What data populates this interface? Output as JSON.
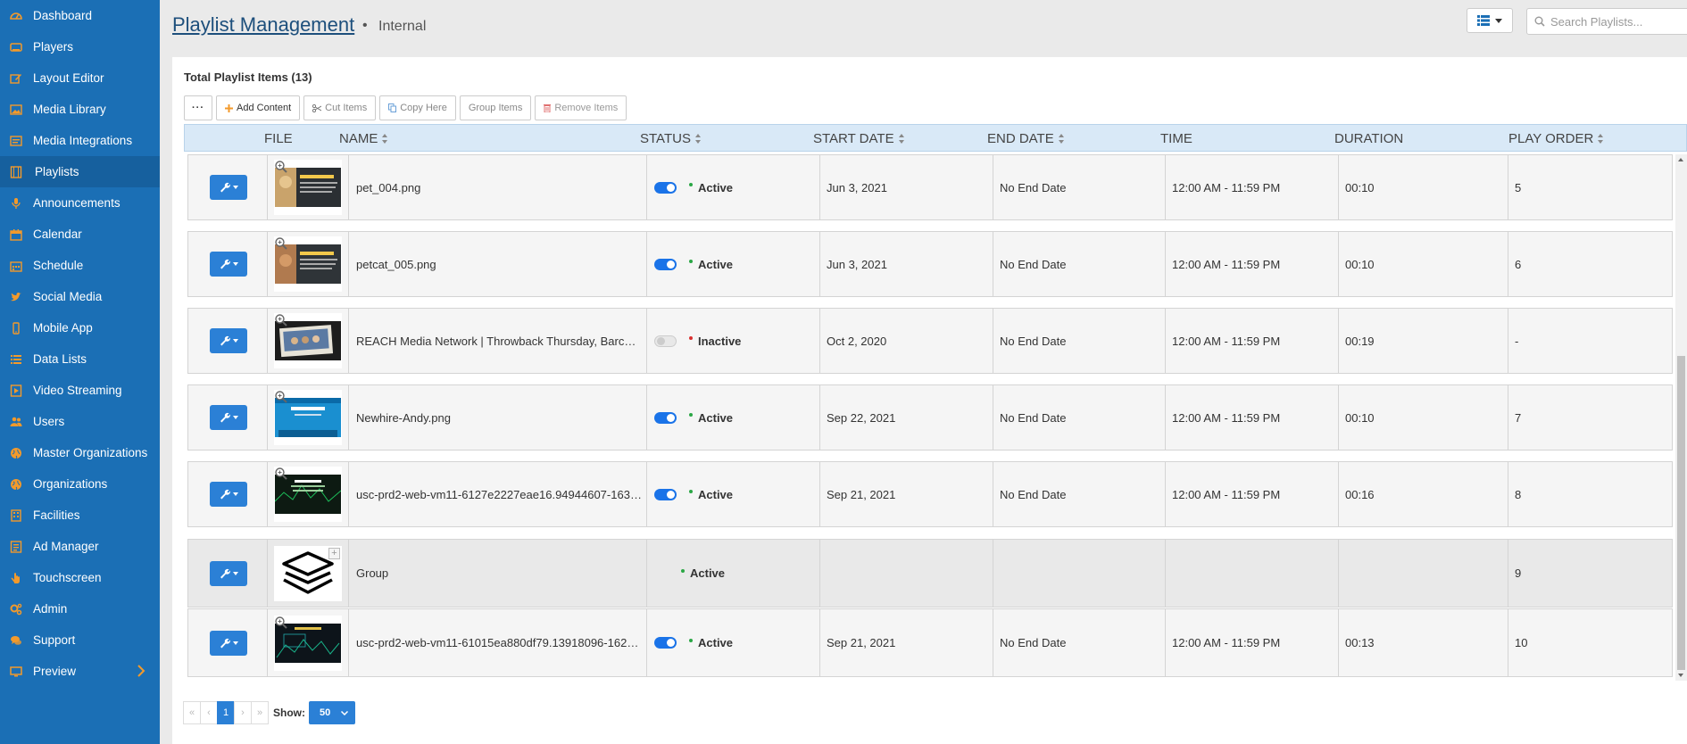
{
  "sidebar": {
    "items": [
      {
        "label": "Dashboard",
        "icon": "dashboard-icon"
      },
      {
        "label": "Players",
        "icon": "player-icon"
      },
      {
        "label": "Layout Editor",
        "icon": "edit-icon"
      },
      {
        "label": "Media Library",
        "icon": "image-icon"
      },
      {
        "label": "Media Integrations",
        "icon": "integrations-icon"
      },
      {
        "label": "Playlists",
        "icon": "film-icon"
      },
      {
        "label": "Announcements",
        "icon": "microphone-icon"
      },
      {
        "label": "Calendar",
        "icon": "calendar-icon"
      },
      {
        "label": "Schedule",
        "icon": "schedule-icon"
      },
      {
        "label": "Social Media",
        "icon": "twitter-icon"
      },
      {
        "label": "Mobile App",
        "icon": "mobile-icon"
      },
      {
        "label": "Data Lists",
        "icon": "list-icon"
      },
      {
        "label": "Video Streaming",
        "icon": "video-icon"
      },
      {
        "label": "Users",
        "icon": "users-icon"
      },
      {
        "label": "Master Organizations",
        "icon": "globe-icon"
      },
      {
        "label": "Organizations",
        "icon": "globe-icon"
      },
      {
        "label": "Facilities",
        "icon": "building-icon"
      },
      {
        "label": "Ad Manager",
        "icon": "ad-icon"
      },
      {
        "label": "Touchscreen",
        "icon": "hand-icon"
      },
      {
        "label": "Admin",
        "icon": "cogs-icon"
      },
      {
        "label": "Support",
        "icon": "chat-icon"
      },
      {
        "label": "Preview",
        "icon": "monitor-icon"
      }
    ],
    "active": "Playlists",
    "accent_color": "#f39a2b"
  },
  "header": {
    "title": "Playlist Management",
    "separator": "•",
    "subtitle": "Internal",
    "search_placeholder": "Search Playlists..."
  },
  "panel": {
    "total_label": "Total Playlist Items (13)",
    "toolbar": {
      "more": "···",
      "add": "Add Content",
      "cut": "Cut Items",
      "copy": "Copy Here",
      "group": "Group Items",
      "remove": "Remove Items"
    }
  },
  "table": {
    "headers": {
      "file": "FILE",
      "name": "NAME",
      "status": "STATUS",
      "start": "START DATE",
      "end": "END DATE",
      "time": "TIME",
      "duration": "DURATION",
      "order": "PLAY ORDER"
    },
    "rows": [
      {
        "name": "pet_004.png",
        "status": "Active",
        "active": true,
        "start": "Jun 3, 2021",
        "end": "No End Date",
        "time": "12:00 AM - 11:59 PM",
        "duration": "00:10",
        "order": "5",
        "thumb": "dog"
      },
      {
        "name": "petcat_005.png",
        "status": "Active",
        "active": true,
        "start": "Jun 3, 2021",
        "end": "No End Date",
        "time": "12:00 AM - 11:59 PM",
        "duration": "00:10",
        "order": "6",
        "thumb": "cat"
      },
      {
        "name": "REACH Media Network | Throwback Thursday, Barcel...",
        "status": "Inactive",
        "active": false,
        "start": "Oct 2, 2020",
        "end": "No End Date",
        "time": "12:00 AM - 11:59 PM",
        "duration": "00:19",
        "order": "-",
        "thumb": "photo"
      },
      {
        "name": "Newhire-Andy.png",
        "status": "Active",
        "active": true,
        "start": "Sep 22, 2021",
        "end": "No End Date",
        "time": "12:00 AM - 11:59 PM",
        "duration": "00:10",
        "order": "7",
        "thumb": "andy"
      },
      {
        "name": "usc-prd2-web-vm11-6127e2227eae16.94944607-1630...",
        "status": "Active",
        "active": true,
        "start": "Sep 21, 2021",
        "end": "No End Date",
        "time": "12:00 AM - 11:59 PM",
        "duration": "00:16",
        "order": "8",
        "thumb": "green"
      },
      {
        "name": "Group",
        "status": "Active",
        "active": null,
        "start": "",
        "end": "",
        "time": "",
        "duration": "",
        "order": "9",
        "thumb": "group"
      },
      {
        "name": "usc-prd2-web-vm11-61015ea880df79.13918096-1627...",
        "status": "Active",
        "active": true,
        "start": "Sep 21, 2021",
        "end": "No End Date",
        "time": "12:00 AM - 11:59 PM",
        "duration": "00:13",
        "order": "10",
        "thumb": "dark"
      }
    ]
  },
  "pagination": {
    "first": "«",
    "prev": "‹",
    "current": "1",
    "next": "›",
    "last": "»",
    "show_label": "Show:",
    "page_size": "50"
  }
}
